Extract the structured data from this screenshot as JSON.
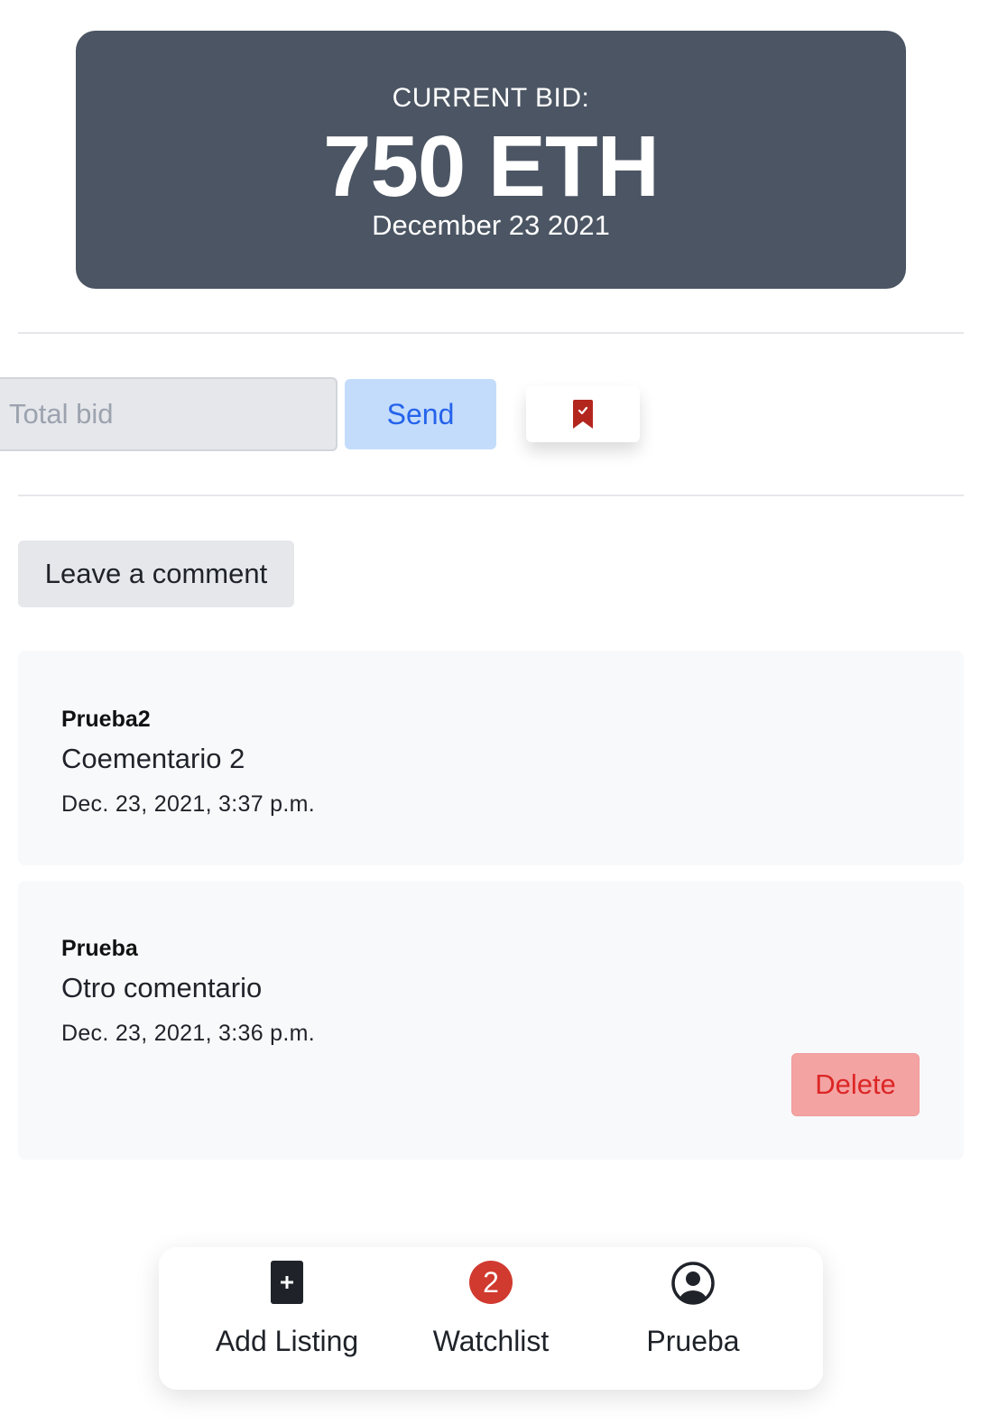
{
  "bid": {
    "label": "CURRENT BID:",
    "amount": "750 ETH",
    "date": "December 23 2021"
  },
  "bid_form": {
    "placeholder": "Total bid",
    "send_label": "Send",
    "watchlist_icon": "bookmark-check-icon",
    "watchlist_icon_color": "#b3261e"
  },
  "comment_button_label": "Leave a comment",
  "comments": [
    {
      "author": "Prueba2",
      "text": "Coementario 2",
      "date": "Dec. 23, 2021, 3:37 p.m."
    },
    {
      "author": "Prueba",
      "text": "Otro comentario",
      "date": "Dec. 23, 2021, 3:36 p.m.",
      "delete_label": "Delete"
    }
  ],
  "nav": {
    "add_listing": {
      "label": "Add Listing",
      "icon": "plus-square-icon"
    },
    "watchlist": {
      "label": "Watchlist",
      "count": "2",
      "icon": "badge-count"
    },
    "profile": {
      "label": "Prueba",
      "icon": "user-circle-icon"
    }
  },
  "colors": {
    "bid_card": "#4b5563",
    "send_button": "#c3dcfb",
    "delete_button": "#f4a3a3",
    "badge": "#d13a2f"
  }
}
